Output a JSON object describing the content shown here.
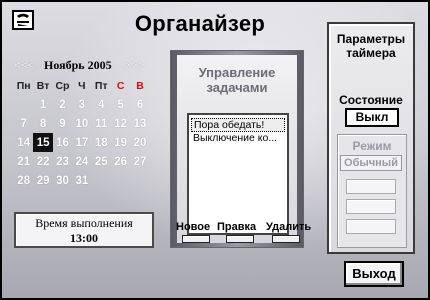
{
  "app": {
    "title": "Органайзер"
  },
  "calendar": {
    "prev_label": "<<<",
    "month_label": "Ноябрь 2005",
    "next_label": ">>>",
    "weekdays": [
      "Пн",
      "Вт",
      "Ср",
      "Ч",
      "Пт",
      "С",
      "В"
    ],
    "weeks": [
      [
        "",
        "1",
        "2",
        "3",
        "4",
        "5",
        "6"
      ],
      [
        "7",
        "8",
        "9",
        "10",
        "11",
        "12",
        "13"
      ],
      [
        "14",
        "15",
        "16",
        "17",
        "18",
        "19",
        "20"
      ],
      [
        "21",
        "22",
        "23",
        "24",
        "25",
        "26",
        "27"
      ],
      [
        "28",
        "29",
        "30",
        "31",
        "",
        "",
        ""
      ]
    ],
    "selected_day": "15"
  },
  "execution": {
    "label": "Время выполнения",
    "time": "13:00"
  },
  "tasks": {
    "title_line1": "Управление",
    "title_line2": "задачами",
    "items": [
      "Пора обедать!",
      "Выключение ко..."
    ],
    "selected_index": 0,
    "new_label": "Новое",
    "edit_label": "Правка",
    "delete_label": "Удалить"
  },
  "timer": {
    "title_line1": "Параметры",
    "title_line2": "таймера",
    "state_label": "Состояние",
    "state_value": "Выкл",
    "mode_label": "Режим",
    "mode_value": "Обычный"
  },
  "exit_label": "Выход",
  "colors": {
    "weekend": "#d01010",
    "today_bg": "#111111",
    "disabled_text": "#9a9aa4"
  }
}
